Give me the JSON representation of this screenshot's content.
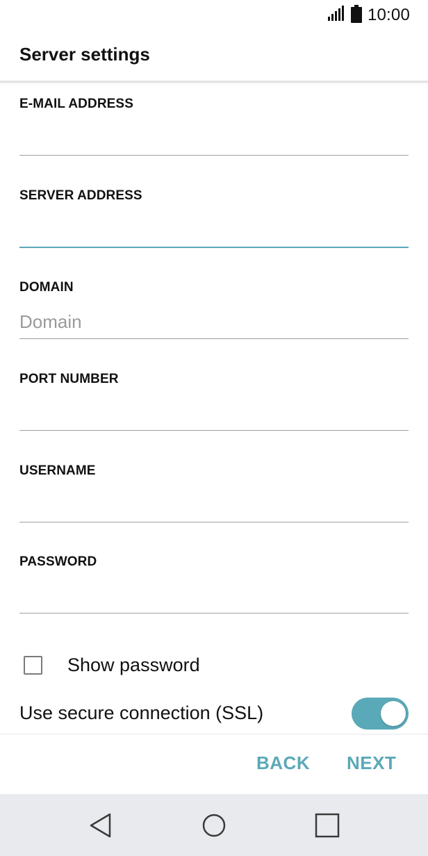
{
  "status_bar": {
    "time": "10:00",
    "signal_icon": "signal-icon",
    "battery_icon": "battery-icon"
  },
  "app_bar": {
    "title": "Server settings"
  },
  "fields": {
    "email": {
      "label": "E-MAIL ADDRESS",
      "value": "",
      "placeholder": ""
    },
    "server": {
      "label": "SERVER ADDRESS",
      "value": "",
      "placeholder": ""
    },
    "domain": {
      "label": "DOMAIN",
      "value": "",
      "placeholder": "Domain"
    },
    "port": {
      "label": "PORT NUMBER",
      "value": "",
      "placeholder": ""
    },
    "username": {
      "label": "USERNAME",
      "value": "",
      "placeholder": ""
    },
    "password": {
      "label": "PASSWORD",
      "value": "",
      "placeholder": ""
    }
  },
  "show_password": {
    "label": "Show password",
    "checked": false
  },
  "ssl": {
    "label": "Use secure connection (SSL)",
    "enabled": true
  },
  "buttons": {
    "back": "BACK",
    "next": "NEXT"
  },
  "nav_bar": {
    "back_icon": "back-triangle-icon",
    "home_icon": "home-circle-icon",
    "recent_icon": "recent-apps-square-icon"
  },
  "colors": {
    "accent": "#5aa9b8",
    "divider": "#9e9e9e",
    "nav_background": "#e8eaed"
  }
}
